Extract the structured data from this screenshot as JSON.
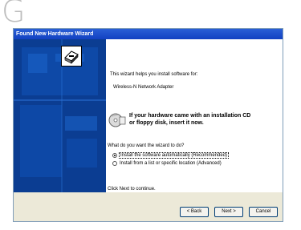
{
  "step_letter": "G",
  "window": {
    "title": "Found New Hardware Wizard"
  },
  "content": {
    "intro": "This wizard helps you install software for:",
    "device": "Wireless-N Network Adapter",
    "cd_line1": "If your hardware came with an installation CD",
    "cd_line2": "or floppy disk, insert it now.",
    "question": "What do you want the wizard to do?",
    "option_auto": "Install the software automatically (Recommended)",
    "option_list": "Install from a list or specific location (Advanced)",
    "continue_text": "Click Next to continue."
  },
  "buttons": {
    "back": "< Back",
    "next": "Next >",
    "cancel": "Cancel"
  },
  "colors": {
    "titlebar": "#2a5fd6",
    "left_panel": "#0a3a8c"
  }
}
